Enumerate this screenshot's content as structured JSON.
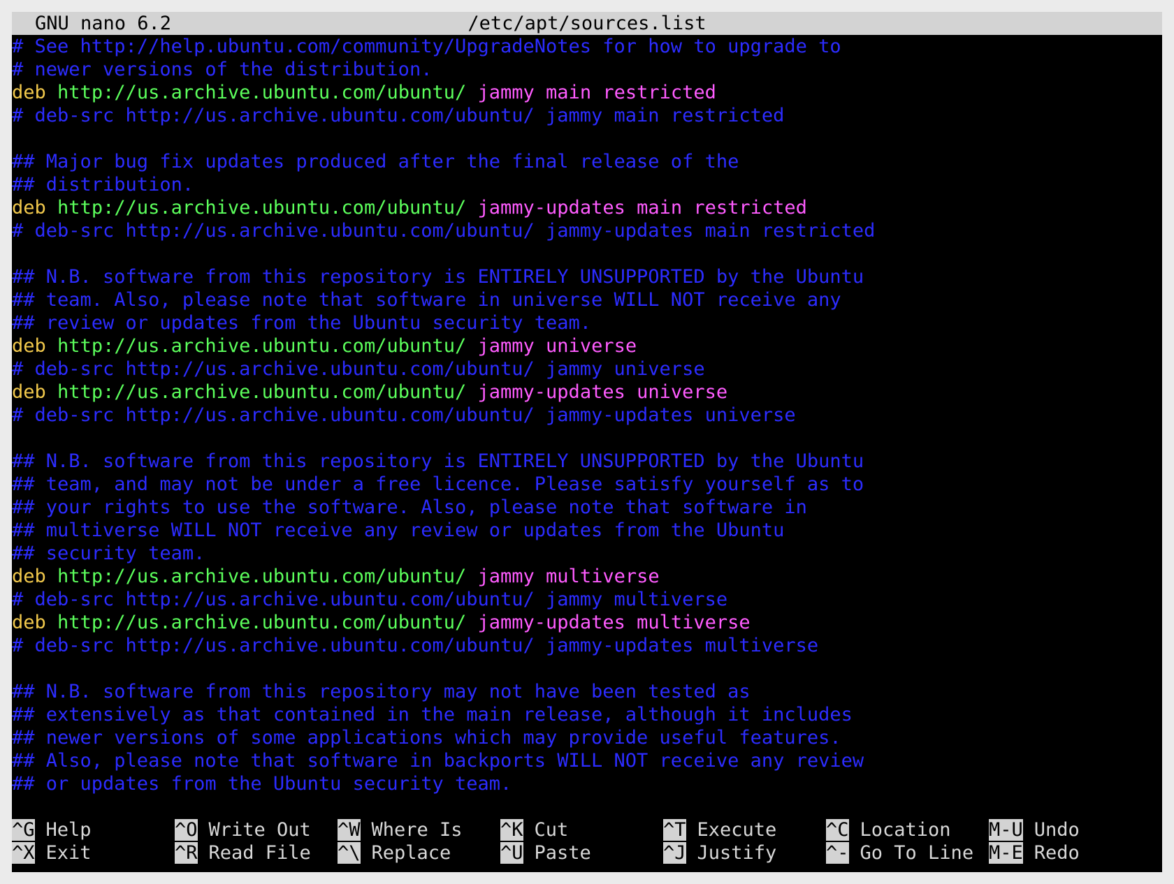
{
  "header": {
    "version": "GNU nano 6.2",
    "filename": "/etc/apt/sources.list"
  },
  "colors": {
    "background": "#000000",
    "comment": "#2c2cff",
    "deb_keyword": "#f2c94c",
    "url": "#5cff5c",
    "distribution": "#ff5cff",
    "bar": "#d3d3d3"
  },
  "lines": [
    {
      "type": "comment",
      "text": "# See http://help.ubuntu.com/community/UpgradeNotes for how to upgrade to"
    },
    {
      "type": "comment",
      "text": "# newer versions of the distribution."
    },
    {
      "type": "deb",
      "keyword": "deb",
      "url": "http://us.archive.ubuntu.com/ubuntu/",
      "dist": "jammy main restricted"
    },
    {
      "type": "comment",
      "text": "# deb-src http://us.archive.ubuntu.com/ubuntu/ jammy main restricted"
    },
    {
      "type": "blank",
      "text": ""
    },
    {
      "type": "comment",
      "text": "## Major bug fix updates produced after the final release of the"
    },
    {
      "type": "comment",
      "text": "## distribution."
    },
    {
      "type": "deb",
      "keyword": "deb",
      "url": "http://us.archive.ubuntu.com/ubuntu/",
      "dist": "jammy-updates main restricted"
    },
    {
      "type": "comment",
      "text": "# deb-src http://us.archive.ubuntu.com/ubuntu/ jammy-updates main restricted"
    },
    {
      "type": "blank",
      "text": ""
    },
    {
      "type": "comment",
      "text": "## N.B. software from this repository is ENTIRELY UNSUPPORTED by the Ubuntu"
    },
    {
      "type": "comment",
      "text": "## team. Also, please note that software in universe WILL NOT receive any"
    },
    {
      "type": "comment",
      "text": "## review or updates from the Ubuntu security team."
    },
    {
      "type": "deb",
      "keyword": "deb",
      "url": "http://us.archive.ubuntu.com/ubuntu/",
      "dist": "jammy universe"
    },
    {
      "type": "comment",
      "text": "# deb-src http://us.archive.ubuntu.com/ubuntu/ jammy universe"
    },
    {
      "type": "deb",
      "keyword": "deb",
      "url": "http://us.archive.ubuntu.com/ubuntu/",
      "dist": "jammy-updates universe"
    },
    {
      "type": "comment",
      "text": "# deb-src http://us.archive.ubuntu.com/ubuntu/ jammy-updates universe"
    },
    {
      "type": "blank",
      "text": ""
    },
    {
      "type": "comment",
      "text": "## N.B. software from this repository is ENTIRELY UNSUPPORTED by the Ubuntu"
    },
    {
      "type": "comment",
      "text": "## team, and may not be under a free licence. Please satisfy yourself as to"
    },
    {
      "type": "comment",
      "text": "## your rights to use the software. Also, please note that software in"
    },
    {
      "type": "comment",
      "text": "## multiverse WILL NOT receive any review or updates from the Ubuntu"
    },
    {
      "type": "comment",
      "text": "## security team."
    },
    {
      "type": "deb",
      "keyword": "deb",
      "url": "http://us.archive.ubuntu.com/ubuntu/",
      "dist": "jammy multiverse"
    },
    {
      "type": "comment",
      "text": "# deb-src http://us.archive.ubuntu.com/ubuntu/ jammy multiverse"
    },
    {
      "type": "deb",
      "keyword": "deb",
      "url": "http://us.archive.ubuntu.com/ubuntu/",
      "dist": "jammy-updates multiverse"
    },
    {
      "type": "comment",
      "text": "# deb-src http://us.archive.ubuntu.com/ubuntu/ jammy-updates multiverse"
    },
    {
      "type": "blank",
      "text": ""
    },
    {
      "type": "comment",
      "text": "## N.B. software from this repository may not have been tested as"
    },
    {
      "type": "comment",
      "text": "## extensively as that contained in the main release, although it includes"
    },
    {
      "type": "comment",
      "text": "## newer versions of some applications which may provide useful features."
    },
    {
      "type": "comment",
      "text": "## Also, please note that software in backports WILL NOT receive any review"
    },
    {
      "type": "comment",
      "text": "## or updates from the Ubuntu security team."
    }
  ],
  "shortcuts": {
    "row1": [
      {
        "key": "^G",
        "label": "Help"
      },
      {
        "key": "^O",
        "label": "Write Out"
      },
      {
        "key": "^W",
        "label": "Where Is"
      },
      {
        "key": "^K",
        "label": "Cut"
      },
      {
        "key": "^T",
        "label": "Execute"
      },
      {
        "key": "^C",
        "label": "Location"
      },
      {
        "key": "M-U",
        "label": "Undo"
      }
    ],
    "row2": [
      {
        "key": "^X",
        "label": "Exit"
      },
      {
        "key": "^R",
        "label": "Read File"
      },
      {
        "key": "^\\",
        "label": "Replace"
      },
      {
        "key": "^U",
        "label": "Paste"
      },
      {
        "key": "^J",
        "label": "Justify"
      },
      {
        "key": "^-",
        "label": "Go To Line"
      },
      {
        "key": "M-E",
        "label": "Redo"
      }
    ]
  }
}
